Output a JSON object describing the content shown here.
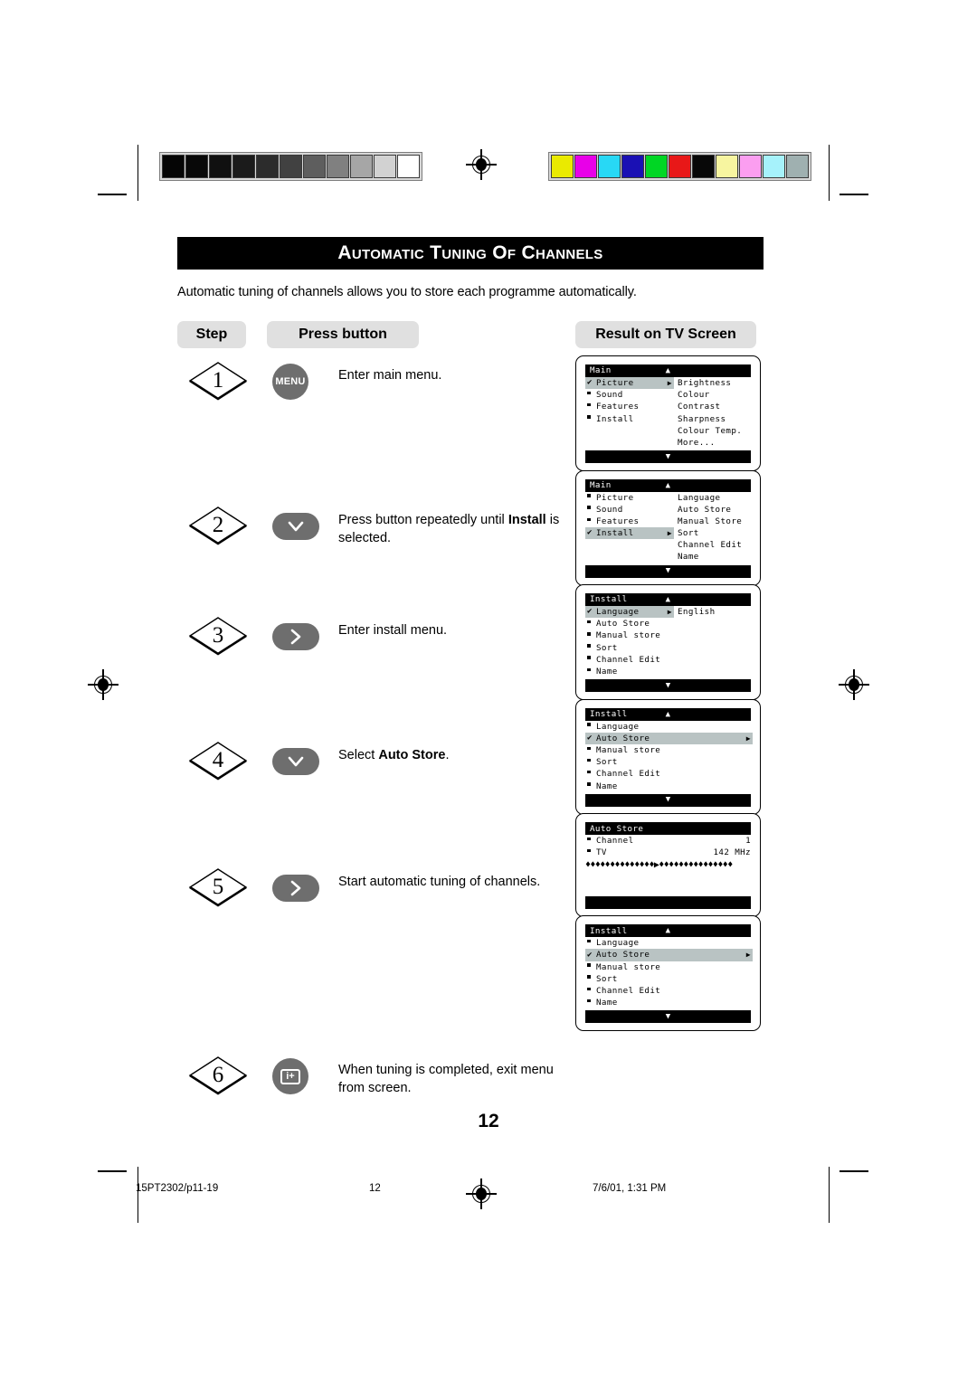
{
  "document": {
    "title": "Automatic Tuning of Channels",
    "intro": "Automatic tuning of channels allows you to store each programme automatically.",
    "page_number": "12"
  },
  "column_headers": {
    "step": "Step",
    "press_button": "Press button",
    "result": "Result on TV Screen"
  },
  "steps": [
    {
      "number": "1",
      "button_icon": "menu-button",
      "button_label": "MENU",
      "text_before": "Enter main menu.",
      "text_bold": "",
      "text_after": ""
    },
    {
      "number": "2",
      "button_icon": "chevron-down-icon",
      "button_label": "",
      "text_before": "Press button repeatedly until ",
      "text_bold": "Install",
      "text_after": " is selected."
    },
    {
      "number": "3",
      "button_icon": "chevron-right-icon",
      "button_label": "",
      "text_before": "Enter install menu.",
      "text_bold": "",
      "text_after": ""
    },
    {
      "number": "4",
      "button_icon": "chevron-down-icon",
      "button_label": "",
      "text_before": "Select ",
      "text_bold": "Auto Store",
      "text_after": "."
    },
    {
      "number": "5",
      "button_icon": "chevron-right-icon",
      "button_label": "",
      "text_before": "Start automatic tuning of channels.",
      "text_bold": "",
      "text_after": ""
    },
    {
      "number": "6",
      "button_icon": "info-plus-icon",
      "button_label": "i+",
      "text_before": "When tuning is completed, exit menu from screen.",
      "text_bold": "",
      "text_after": ""
    }
  ],
  "tv_screens": [
    {
      "title": "Main",
      "up_arrow": "▲",
      "down_arrow": "▼",
      "left_items": [
        {
          "label": "Picture",
          "selected": true,
          "check": true,
          "arrow": true
        },
        {
          "label": "Sound",
          "selected": false,
          "check": false,
          "arrow": false
        },
        {
          "label": "Features",
          "selected": false,
          "check": false,
          "arrow": false
        },
        {
          "label": "Install",
          "selected": false,
          "check": false,
          "arrow": false
        }
      ],
      "right_items": [
        "Brightness",
        "Colour",
        "Contrast",
        "Sharpness",
        "Colour Temp.",
        "More..."
      ],
      "has_footer": true
    },
    {
      "title": "Main",
      "up_arrow": "▲",
      "down_arrow": "▼",
      "left_items": [
        {
          "label": "Picture",
          "selected": false,
          "check": false,
          "arrow": false
        },
        {
          "label": "Sound",
          "selected": false,
          "check": false,
          "arrow": false
        },
        {
          "label": "Features",
          "selected": false,
          "check": false,
          "arrow": false
        },
        {
          "label": "Install",
          "selected": true,
          "check": true,
          "arrow": true
        }
      ],
      "right_items": [
        "Language",
        "Auto Store",
        "Manual Store",
        "Sort",
        "Channel Edit",
        "Name"
      ],
      "has_footer": true
    },
    {
      "title": "Install",
      "up_arrow": "▲",
      "down_arrow": "▼",
      "left_items": [
        {
          "label": "Language",
          "selected": true,
          "check": true,
          "arrow": true
        },
        {
          "label": "Auto Store",
          "selected": false,
          "check": false,
          "arrow": false
        },
        {
          "label": "Manual store",
          "selected": false,
          "check": false,
          "arrow": false
        },
        {
          "label": "Sort",
          "selected": false,
          "check": false,
          "arrow": false
        },
        {
          "label": "Channel Edit",
          "selected": false,
          "check": false,
          "arrow": false
        },
        {
          "label": "Name",
          "selected": false,
          "check": false,
          "arrow": false
        }
      ],
      "right_items": [
        "English"
      ],
      "has_footer": true
    },
    {
      "title": "Install",
      "up_arrow": "▲",
      "down_arrow": "▼",
      "wide": true,
      "left_items": [
        {
          "label": "Language",
          "selected": false,
          "check": false,
          "arrow": false
        },
        {
          "label": "Auto Store",
          "selected": true,
          "check": true,
          "arrow": true
        },
        {
          "label": "Manual store",
          "selected": false,
          "check": false,
          "arrow": false
        },
        {
          "label": "Sort",
          "selected": false,
          "check": false,
          "arrow": false
        },
        {
          "label": "Channel Edit",
          "selected": false,
          "check": false,
          "arrow": false
        },
        {
          "label": "Name",
          "selected": false,
          "check": false,
          "arrow": false
        }
      ],
      "right_items": [],
      "has_footer": true
    },
    {
      "title": "Auto Store",
      "up_arrow": "",
      "down_arrow": "",
      "value_items": [
        {
          "label": "Channel",
          "value": "1"
        },
        {
          "label": "TV",
          "value": "142 MHz"
        }
      ],
      "progress": "♦♦♦♦♦♦♦♦♦♦♦♦♦♦▶♦♦♦♦♦♦♦♦♦♦♦♦♦♦♦",
      "has_footer": true
    },
    {
      "title": "Install",
      "up_arrow": "▲",
      "down_arrow": "▼",
      "wide": true,
      "left_items": [
        {
          "label": "Language",
          "selected": false,
          "check": false,
          "arrow": false
        },
        {
          "label": "Auto Store",
          "selected": true,
          "check": true,
          "arrow": true
        },
        {
          "label": "Manual store",
          "selected": false,
          "check": false,
          "arrow": false
        },
        {
          "label": "Sort",
          "selected": false,
          "check": false,
          "arrow": false
        },
        {
          "label": "Channel Edit",
          "selected": false,
          "check": false,
          "arrow": false
        },
        {
          "label": "Name",
          "selected": false,
          "check": false,
          "arrow": false
        }
      ],
      "right_items": [],
      "has_footer": true
    }
  ],
  "print_marks": {
    "grayscale_swatches": [
      "#050505",
      "#080808",
      "#101010",
      "#1b1b1b",
      "#2c2c2c",
      "#414141",
      "#5e5e5e",
      "#808080",
      "#a6a6a6",
      "#d2d2d2",
      "#ffffff"
    ],
    "color_swatches": [
      "#eaea00",
      "#e800e8",
      "#28d8f5",
      "#1a10b4",
      "#00d624",
      "#e81818",
      "#080808",
      "#f7f5a0",
      "#fb9ef0",
      "#a6f2fb",
      "#9fb0b0"
    ]
  },
  "footer": {
    "left": "15PT2302/p11-19",
    "middle": "12",
    "right": "7/6/01, 1:31 PM"
  }
}
